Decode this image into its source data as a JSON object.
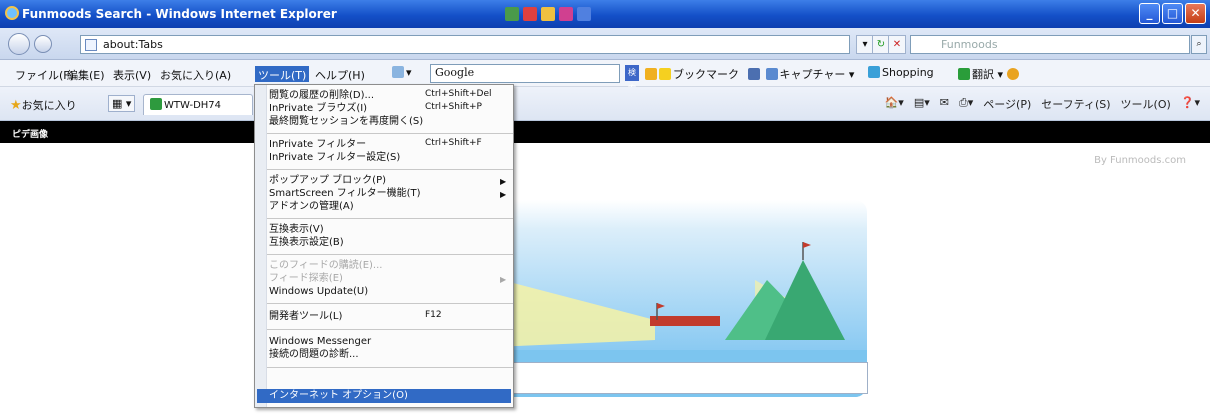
{
  "window": {
    "title": "Funmoods Search - Windows Internet Explorer"
  },
  "address": {
    "value": "about:Tabs",
    "search_placeholder": "Funmoods"
  },
  "menubar": {
    "items": [
      "ファイル(F)",
      "編集(E)",
      "表示(V)",
      "お気に入り(A)",
      "ツール(T)",
      "ヘルプ(H)"
    ],
    "active_index": 4
  },
  "toolbar": {
    "google_text": "Google",
    "search_btn": "検索",
    "bookmark": "ブックマーク",
    "capture": "キャプチャー",
    "shopping": "Shopping",
    "translate": "翻訳"
  },
  "favorites": {
    "label": "お気に入り",
    "tab_label": "WTW-DH74",
    "commands": [
      "ページ(P)",
      "セーフティ(S)",
      "ツール(O)"
    ]
  },
  "page": {
    "black_bar": "ピデ画像",
    "byline": "By Funmoods.com"
  },
  "tools_menu": {
    "items": [
      {
        "label": "閲覧の履歴の削除(D)...",
        "shortcut": "Ctrl+Shift+Del"
      },
      {
        "label": "InPrivate ブラウズ(I)",
        "shortcut": "Ctrl+Shift+P"
      },
      {
        "label": "最終閲覧セッションを再度開く(S)",
        "shortcut": ""
      },
      {
        "label": "InPrivate フィルター",
        "shortcut": "Ctrl+Shift+F"
      },
      {
        "label": "InPrivate フィルター設定(S)",
        "shortcut": ""
      },
      {
        "label": "ポップアップ ブロック(P)",
        "shortcut": ""
      },
      {
        "label": "SmartScreen フィルター機能(T)",
        "shortcut": ""
      },
      {
        "label": "アドオンの管理(A)",
        "shortcut": ""
      },
      {
        "label": "互換表示(V)",
        "shortcut": ""
      },
      {
        "label": "互換表示設定(B)",
        "shortcut": ""
      },
      {
        "label": "このフィードの購読(E)...",
        "shortcut": ""
      },
      {
        "label": "フィード探索(E)",
        "shortcut": ""
      },
      {
        "label": "Windows Update(U)",
        "shortcut": ""
      },
      {
        "label": "開発者ツール(L)",
        "shortcut": "F12"
      },
      {
        "label": "Windows Messenger",
        "shortcut": ""
      },
      {
        "label": "接続の問題の診断...",
        "shortcut": ""
      },
      {
        "label": "インターネット オプション(O)",
        "shortcut": ""
      }
    ]
  }
}
